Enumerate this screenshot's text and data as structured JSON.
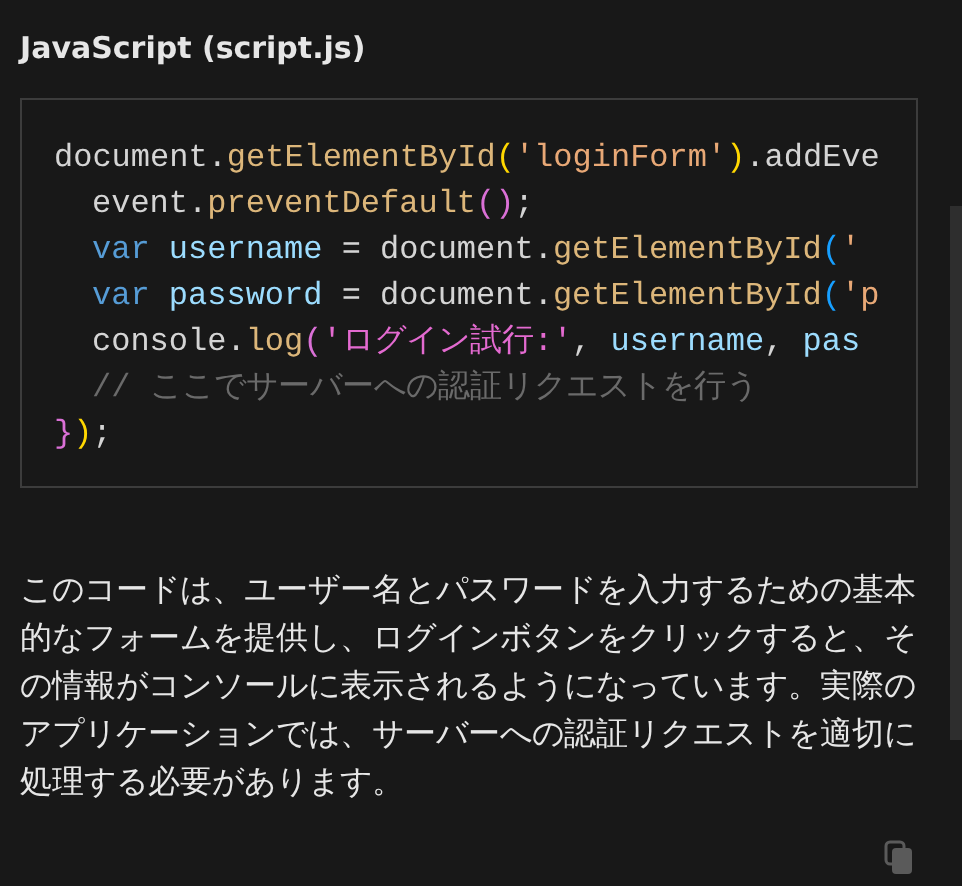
{
  "heading": "JavaScript (script.js)",
  "code": {
    "lines": [
      {
        "indented": false,
        "tokens": [
          {
            "kind": "plain",
            "text": "document."
          },
          {
            "kind": "function",
            "text": "getElementById"
          },
          {
            "kind": "bracket1",
            "text": "("
          },
          {
            "kind": "string",
            "text": "'loginForm'"
          },
          {
            "kind": "bracket1",
            "text": ")"
          },
          {
            "kind": "plain",
            "text": ".addEve"
          }
        ]
      },
      {
        "indented": true,
        "tokens": [
          {
            "kind": "plain",
            "text": "event."
          },
          {
            "kind": "function",
            "text": "preventDefault"
          },
          {
            "kind": "bracket2",
            "text": "()"
          },
          {
            "kind": "plain",
            "text": ";"
          }
        ]
      },
      {
        "indented": true,
        "tokens": [
          {
            "kind": "keyword",
            "text": "var "
          },
          {
            "kind": "variable",
            "text": "username"
          },
          {
            "kind": "plain",
            "text": " = document."
          },
          {
            "kind": "function",
            "text": "getElementById"
          },
          {
            "kind": "bracket3",
            "text": "("
          },
          {
            "kind": "string",
            "text": "'"
          }
        ]
      },
      {
        "indented": true,
        "tokens": [
          {
            "kind": "keyword",
            "text": "var "
          },
          {
            "kind": "variable",
            "text": "password"
          },
          {
            "kind": "plain",
            "text": " = document."
          },
          {
            "kind": "function",
            "text": "getElementById"
          },
          {
            "kind": "bracket3",
            "text": "("
          },
          {
            "kind": "string",
            "text": "'p"
          }
        ]
      },
      {
        "indented": true,
        "tokens": [
          {
            "kind": "plain",
            "text": "console."
          },
          {
            "kind": "function",
            "text": "log"
          },
          {
            "kind": "bracket2",
            "text": "("
          },
          {
            "kind": "string2",
            "text": "'ログイン試行:'"
          },
          {
            "kind": "plain",
            "text": ", "
          },
          {
            "kind": "variable",
            "text": "username"
          },
          {
            "kind": "plain",
            "text": ", "
          },
          {
            "kind": "variable",
            "text": "pas"
          }
        ]
      },
      {
        "indented": true,
        "tokens": [
          {
            "kind": "comment",
            "text": "// ここでサーバーへの認証リクエストを行う"
          }
        ]
      },
      {
        "indented": false,
        "tokens": [
          {
            "kind": "bracket2",
            "text": "}"
          },
          {
            "kind": "bracket1",
            "text": ")"
          },
          {
            "kind": "plain",
            "text": ";"
          }
        ]
      }
    ]
  },
  "description": "このコードは、ユーザー名とパスワードを入力するための基本的なフォームを提供し、ログインボタンをクリックすると、その情報がコンソールに表示されるようになっています。実際のアプリケーションでは、サーバーへの認証リクエストを適切に処理する必要があります。"
}
